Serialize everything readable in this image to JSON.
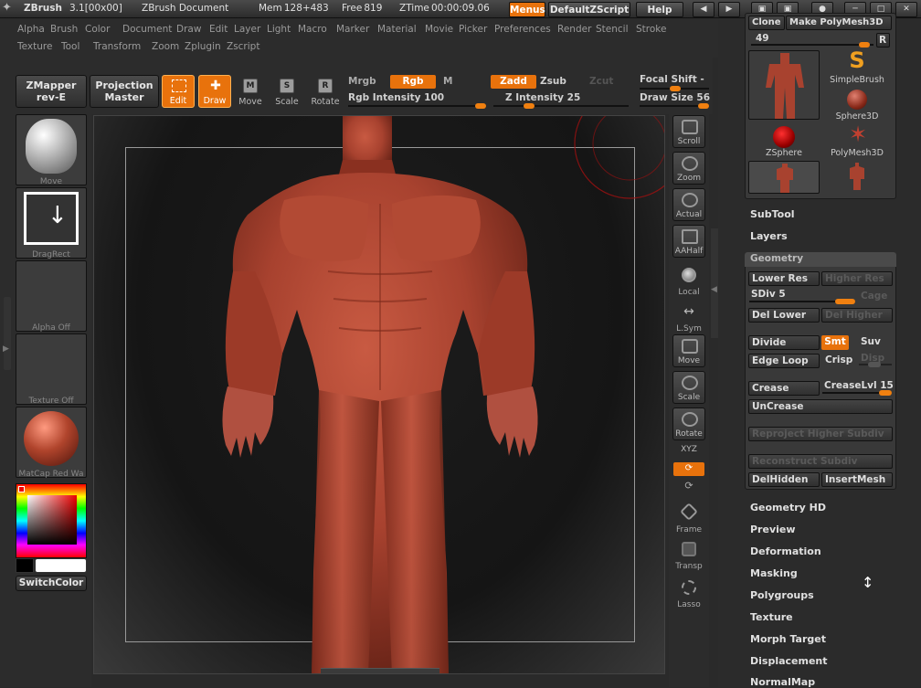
{
  "title_bar": {
    "app": "ZBrush",
    "version": "3.1[00x00]",
    "document": "ZBrush Document",
    "mem": "Mem 128+483",
    "free": "Free 819",
    "ztime": "ZTime 00:00:09.06",
    "menus_label": "Menus",
    "zscript_label": "DefaultZScript",
    "help_label": "Help"
  },
  "menu_row1": [
    "Alpha",
    "Brush",
    "Color",
    "Document",
    "Draw",
    "Edit",
    "Layer",
    "Light",
    "Macro",
    "Marker",
    "Material",
    "Movie",
    "Picker",
    "Preferences",
    "Render",
    "Stencil",
    "Stroke"
  ],
  "menu_row2": [
    "Texture",
    "Tool",
    "Transform",
    "Zoom",
    "Zplugin",
    "Zscript"
  ],
  "toolbar": {
    "zmapper_line1": "ZMapper",
    "zmapper_line2": "rev-E",
    "projection_line1": "Projection",
    "projection_line2": "Master",
    "edit": "Edit",
    "draw": "Draw",
    "move": "Move",
    "scale": "Scale",
    "rotate": "Rotate",
    "move_glyph": "M",
    "scale_glyph": "S",
    "rotate_glyph": "R",
    "mrgb": "Mrgb",
    "rgb": "Rgb",
    "m": "M",
    "rgb_intensity": "Rgb Intensity 100",
    "zadd": "Zadd",
    "zsub": "Zsub",
    "zcut": "Zcut",
    "z_intensity": "Z Intensity 25",
    "focal_shift": "Focal Shift -",
    "draw_size": "Draw Size 56"
  },
  "left_shelf": {
    "brush": "Move",
    "stroke": "DragRect",
    "alpha": "Alpha Off",
    "texture": "Texture Off",
    "material": "MatCap Red Wa",
    "switch_color": "SwitchColor"
  },
  "right_shelf": {
    "scroll": "Scroll",
    "zoom": "Zoom",
    "actual": "Actual",
    "aahalf": "AAHalf",
    "local": "Local",
    "lsym": "L.Sym",
    "move": "Move",
    "scale": "Scale",
    "rotate": "Rotate",
    "xyz": "XYZ",
    "frame": "Frame",
    "transp": "Transp",
    "lasso": "Lasso"
  },
  "tool_palette": {
    "clone": "Clone",
    "make_polymesh": "Make PolyMesh3D",
    "slider_value": "49",
    "r_label": "R",
    "tools": [
      "SimpleBrush",
      "Sphere3D",
      "ZSphere",
      "PolyMesh3D"
    ]
  },
  "subpalettes_top": [
    "SubTool",
    "Layers"
  ],
  "geometry": {
    "title": "Geometry",
    "lower_res": "Lower Res",
    "higher_res": "Higher Res",
    "sdiv": "SDiv 5",
    "cage": "Cage",
    "del_lower": "Del Lower",
    "del_higher": "Del Higher",
    "divide": "Divide",
    "smt": "Smt",
    "suv": "Suv",
    "edge_loop": "Edge Loop",
    "crisp": "Crisp",
    "disp": "Disp",
    "crease": "Crease",
    "crease_lvl": "CreaseLvl 15",
    "uncrease": "UnCrease",
    "reproject": "Reproject Higher Subdiv",
    "reconstruct": "Reconstruct Subdiv",
    "del_hidden": "DelHidden",
    "insert_mesh": "InsertMesh"
  },
  "subpalettes_bottom": [
    "Geometry HD",
    "Preview",
    "Deformation",
    "Masking",
    "Polygroups",
    "Texture",
    "Morph Target",
    "Displacement",
    "NormalMap"
  ],
  "colors": {
    "accent": "#e8720c",
    "model": "#a8422f"
  }
}
